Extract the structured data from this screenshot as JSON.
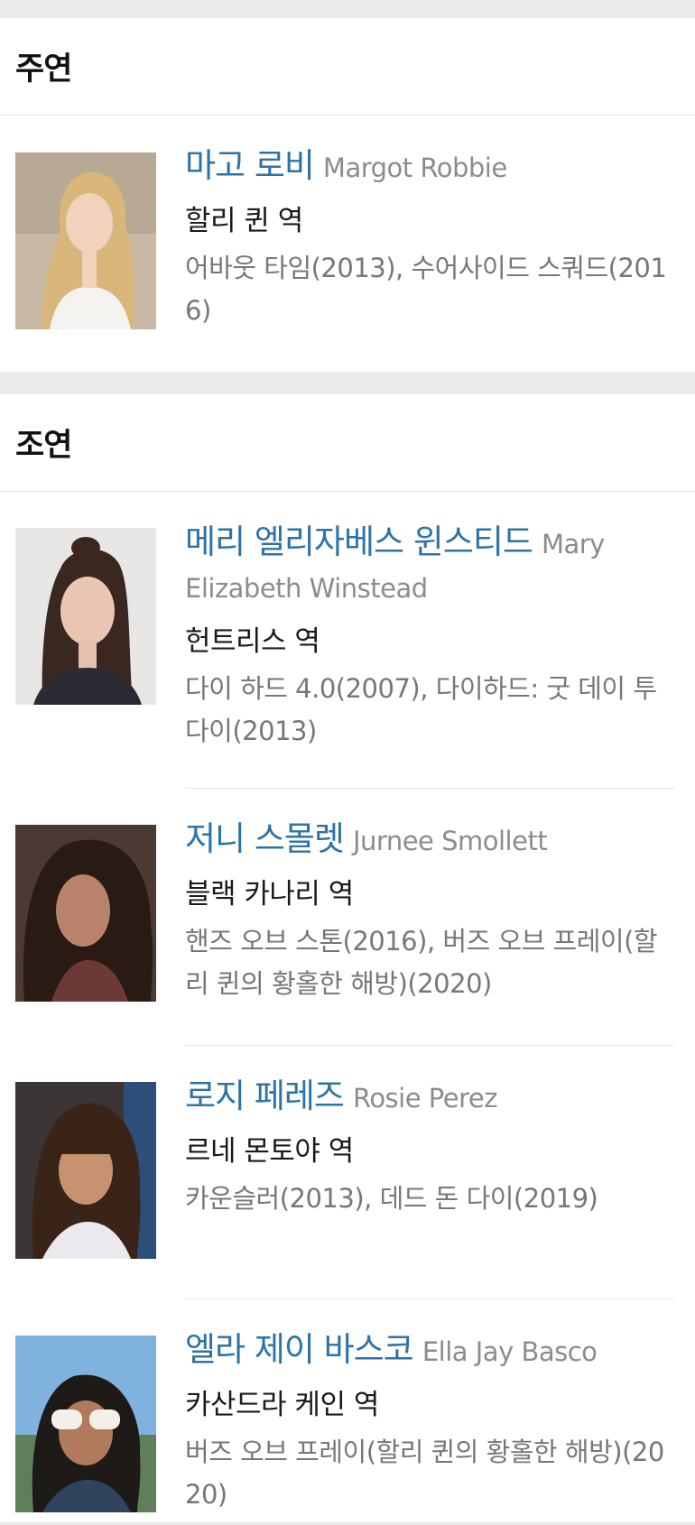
{
  "sections": [
    {
      "title": "주연",
      "cast": [
        {
          "name_ko": "마고 로비",
          "name_en": "Margot Robbie",
          "role": "할리 퀸 역",
          "works": "어바웃 타임(2013), 수어사이드 스쿼드(2016)"
        }
      ]
    },
    {
      "title": "조연",
      "cast": [
        {
          "name_ko": "메리 엘리자베스 윈스티드",
          "name_en": "Mary Elizabeth Winstead",
          "role": "헌트리스 역",
          "works": "다이 하드 4.0(2007), 다이하드: 굿 데이 투 다이(2013)"
        },
        {
          "name_ko": "저니 스몰렛",
          "name_en": "Jurnee Smollett",
          "role": "블랙 카나리 역",
          "works": "핸즈 오브 스톤(2016), 버즈 오브 프레이(할리 퀸의 황홀한 해방)(2020)"
        },
        {
          "name_ko": "로지 페레즈",
          "name_en": "Rosie Perez",
          "role": "르네 몬토야 역",
          "works": "카운슬러(2013), 데드 돈 다이(2019)"
        },
        {
          "name_ko": "엘라 제이 바스코",
          "name_en": "Ella Jay Basco",
          "role": "카산드라 케인 역",
          "works": "버즈 오브 프레이(할리 퀸의 황홀한 해방)(2020)"
        }
      ]
    }
  ]
}
